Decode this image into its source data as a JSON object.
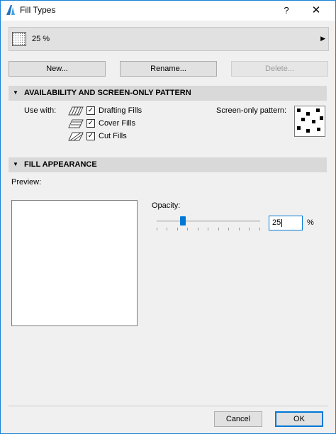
{
  "window": {
    "title": "Fill Types",
    "help_label": "?",
    "close_label": "✕"
  },
  "selector": {
    "value": "25 %"
  },
  "buttons": {
    "new": "New...",
    "rename": "Rename...",
    "delete": "Delete..."
  },
  "availability": {
    "header": "AVAILABILITY AND SCREEN-ONLY PATTERN",
    "use_with_label": "Use with:",
    "options": [
      {
        "label": "Drafting Fills",
        "checked": true,
        "icon": "drafting-fill-icon"
      },
      {
        "label": "Cover Fills",
        "checked": true,
        "icon": "cover-fill-icon"
      },
      {
        "label": "Cut Fills",
        "checked": true,
        "icon": "cut-fill-icon"
      }
    ],
    "screen_only_label": "Screen-only pattern:"
  },
  "appearance": {
    "header": "FILL APPEARANCE",
    "preview_label": "Preview:",
    "opacity_label": "Opacity:",
    "opacity_value": "25",
    "opacity_fraction": 0.25,
    "unit": "%"
  },
  "footer": {
    "cancel": "Cancel",
    "ok": "OK"
  },
  "colors": {
    "accent": "#0078d7",
    "section_bg": "#d9d9d9",
    "border": "#1883d7"
  }
}
